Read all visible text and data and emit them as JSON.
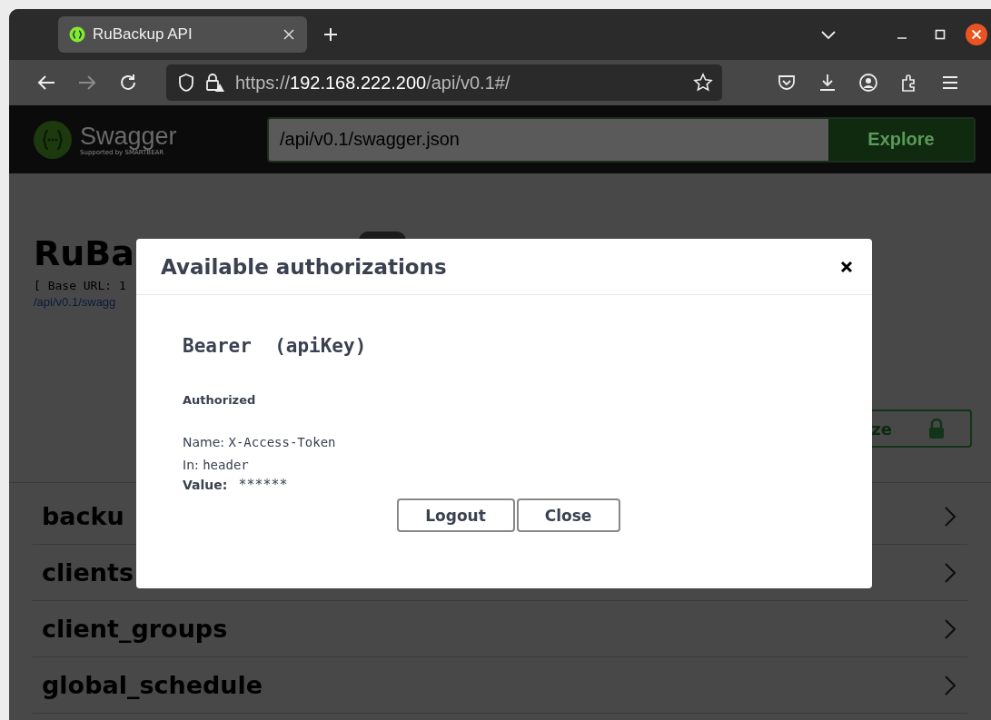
{
  "browser": {
    "tab": {
      "title": "RuBackup API"
    },
    "url": {
      "scheme": "https://",
      "host": "192.168.222.200",
      "path": "/api/v0.1#/"
    }
  },
  "topbar": {
    "logo_text": "Swagger",
    "logo_sub": "Supported by SMARTBEAR",
    "spec_url": "/api/v0.1/swagger.json",
    "explore_button": "Explore"
  },
  "info": {
    "title": "RuBa",
    "base_url": "[ Base URL: 1",
    "spec_link": "/api/v0.1/swagg",
    "authorize_button": "ze"
  },
  "tags": [
    {
      "name": "backu"
    },
    {
      "name": "clients"
    },
    {
      "name": "client_groups"
    },
    {
      "name": "global_schedule"
    }
  ],
  "modal": {
    "title": "Available authorizations",
    "scheme_title": "Bearer  (apiKey)",
    "status": "Authorized",
    "name_label": "Name:",
    "name_value": "X-Access-Token",
    "in_label": "In:",
    "in_value": "header",
    "value_label": "Value:",
    "value_value": "******",
    "buttons": [
      "Logout",
      "Close"
    ]
  }
}
